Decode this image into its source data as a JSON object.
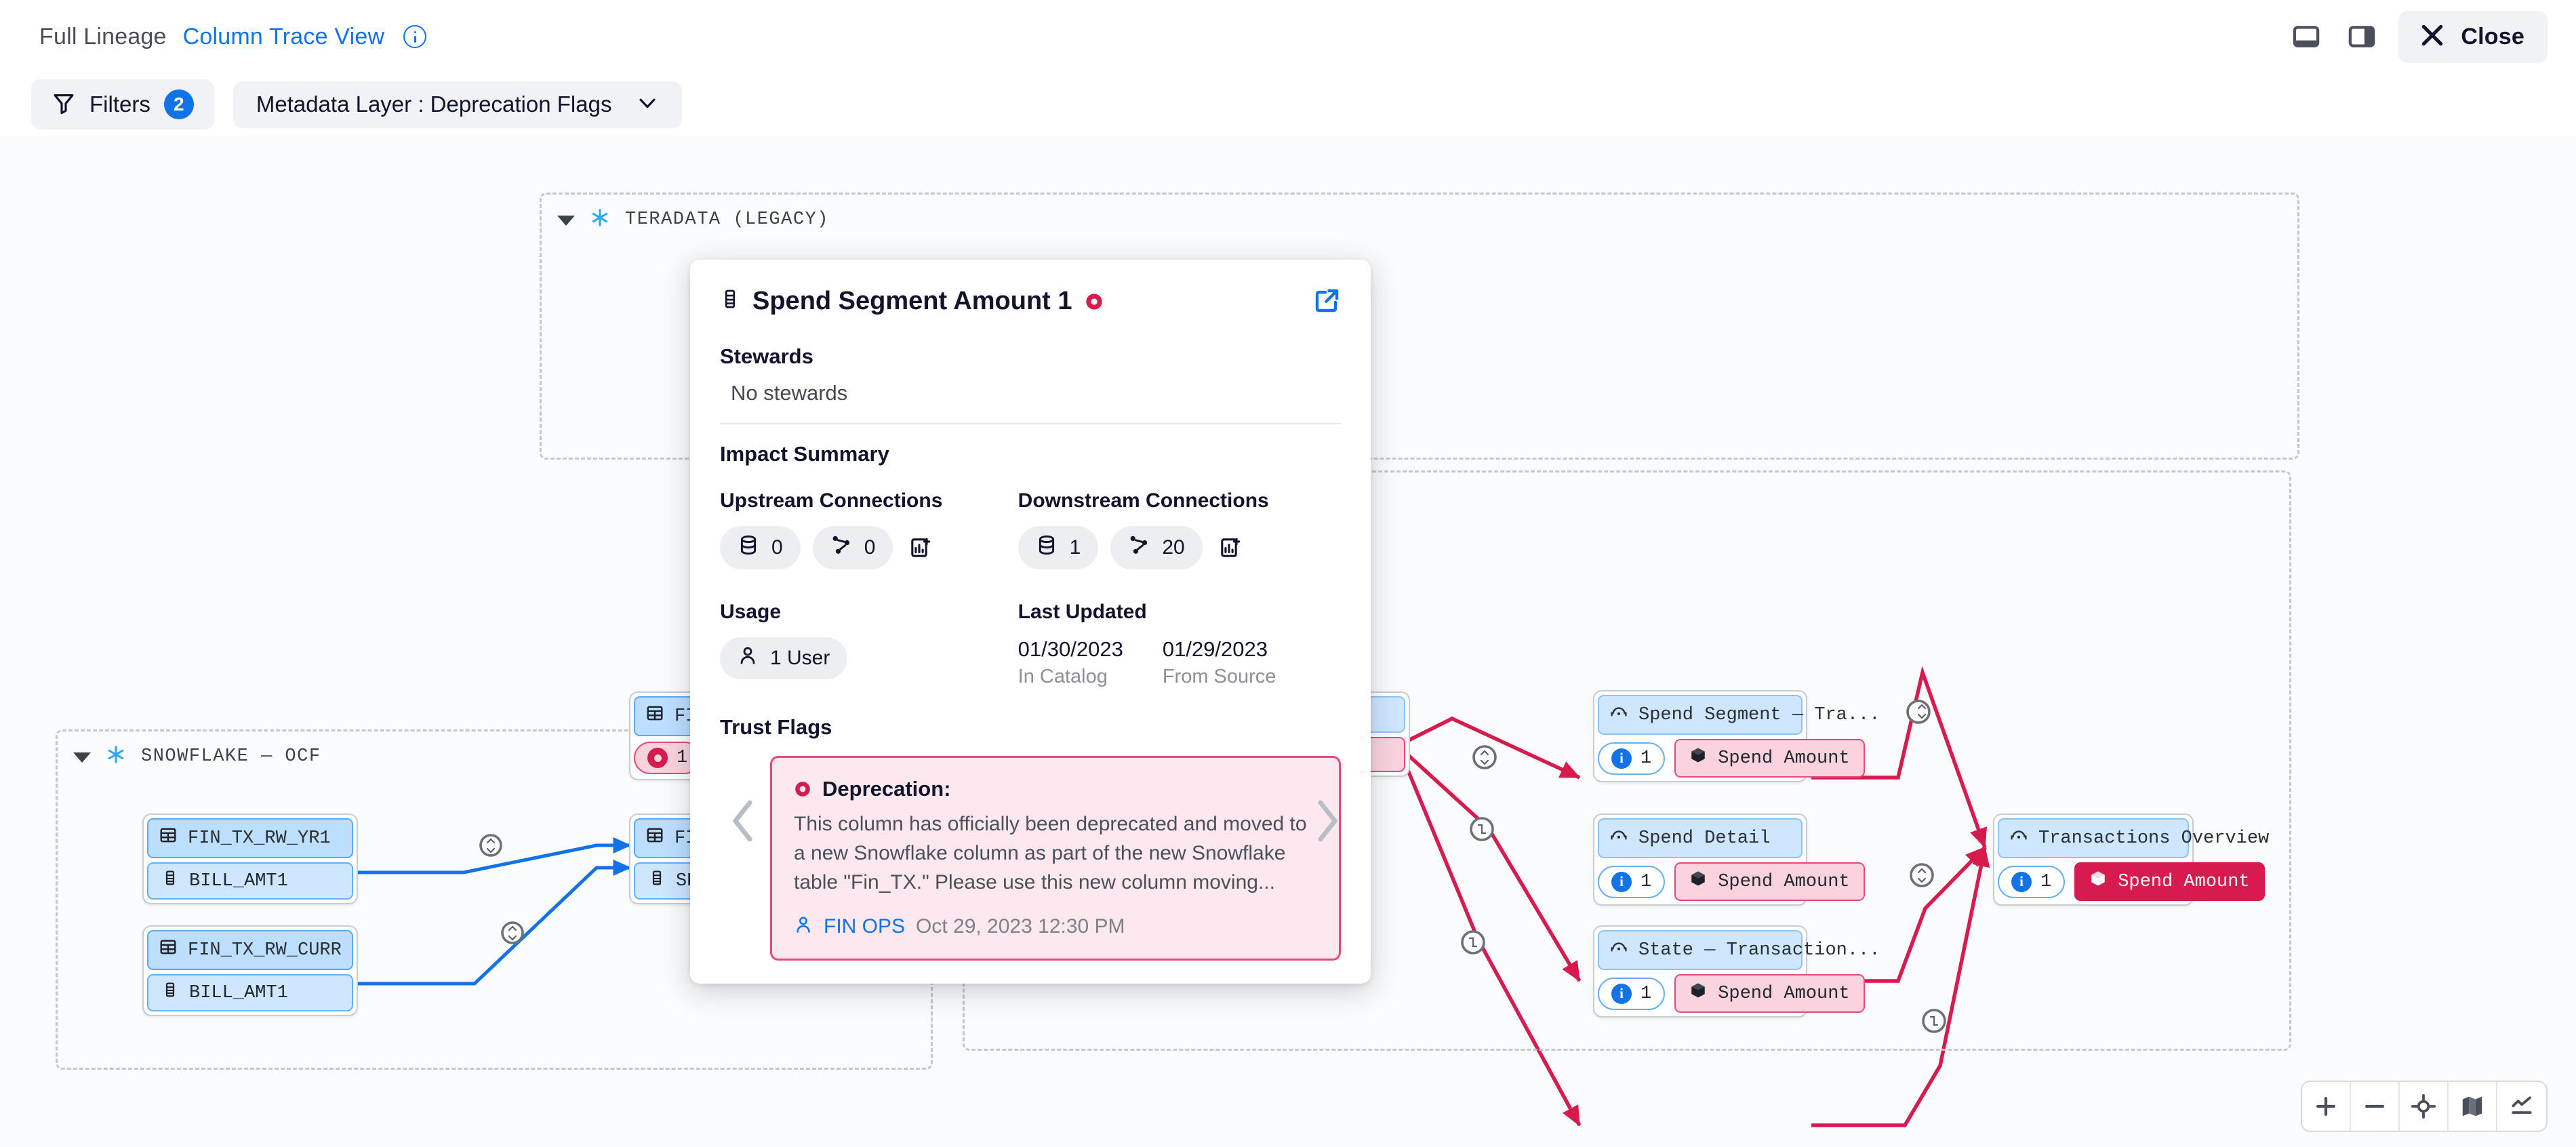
{
  "header": {
    "tabs": [
      {
        "id": "full-lineage",
        "label": "Full Lineage",
        "active": false
      },
      {
        "id": "column-trace-view",
        "label": "Column Trace View",
        "active": true
      }
    ],
    "close_label": "Close"
  },
  "filter_bar": {
    "filters_label": "Filters",
    "filters_count": "2",
    "metadata_layer_label": "Metadata Layer : Deprecation Flags"
  },
  "popover": {
    "title": "Spend Segment Amount 1",
    "stewards_heading": "Stewards",
    "stewards_value": "No stewards",
    "impact_heading": "Impact Summary",
    "upstream_label": "Upstream Connections",
    "upstream_datasets": "0",
    "upstream_reports": "0",
    "downstream_label": "Downstream Connections",
    "downstream_datasets": "1",
    "downstream_reports": "20",
    "usage_label": "Usage",
    "usage_value": "1 User",
    "last_updated_label": "Last Updated",
    "in_catalog_date": "01/30/2023",
    "in_catalog_label": "In Catalog",
    "from_source_date": "01/29/2023",
    "from_source_label": "From Source",
    "trust_flags_label": "Trust Flags",
    "flag_title": "Deprecation:",
    "flag_body": "This column has officially been deprecated and moved to a new Snowflake column as part of the new Snowflake table \"Fin_TX.\" Please use this new column moving...",
    "flag_user": "FIN OPS",
    "flag_date": "Oct 29, 2023 12:30 PM"
  },
  "groups": [
    {
      "id": "teradata",
      "title": "TERADATA  (LEGACY)"
    },
    {
      "id": "snowflake",
      "title": "SNOWFLAKE — OCF"
    },
    {
      "id": "downstream",
      "title": ""
    }
  ],
  "nodes": [
    {
      "id": "fin-tx-legacy",
      "table": "FIN_T",
      "column": "",
      "count": "1",
      "kind": "table",
      "flag": "deprecated"
    },
    {
      "id": "fin-tx-rw-yr1",
      "table": "FIN_TX_RW_YR1",
      "column": "BILL_AMT1",
      "count": "",
      "kind": "table",
      "flag": "none"
    },
    {
      "id": "fin-tx-rw-curr",
      "table": "FIN_TX_RW_CURR",
      "column": "BILL_AMT1",
      "count": "",
      "kind": "table",
      "flag": "none"
    },
    {
      "id": "fin-tx-mid",
      "table": "FIN_T",
      "column": "SPND",
      "count": "",
      "kind": "table",
      "flag": "none"
    },
    {
      "id": "spend-segment-tra",
      "table": "Spend Segment — Tra...",
      "column": "Spend Amount",
      "count": "1",
      "kind": "report",
      "flag": "pink"
    },
    {
      "id": "spend-detail",
      "table": "Spend Detail",
      "column": "Spend Amount",
      "count": "1",
      "kind": "report",
      "flag": "pink"
    },
    {
      "id": "state-transaction",
      "table": "State — Transaction...",
      "column": "Spend Amount",
      "count": "1",
      "kind": "report",
      "flag": "pink"
    },
    {
      "id": "transactions-overview",
      "table": "Transactions Overview",
      "column": "Spend Amount",
      "count": "1",
      "kind": "report",
      "flag": "red"
    }
  ],
  "colors": {
    "accent_blue": "#1273e6",
    "deprecation_red": "#d81b4e",
    "edge_pink": "#d81b4e",
    "edge_blue": "#1273e6",
    "node_header_blue": "#bddfff",
    "column_pink": "#fbd3de",
    "canvas_bg": "#fafbfc"
  }
}
